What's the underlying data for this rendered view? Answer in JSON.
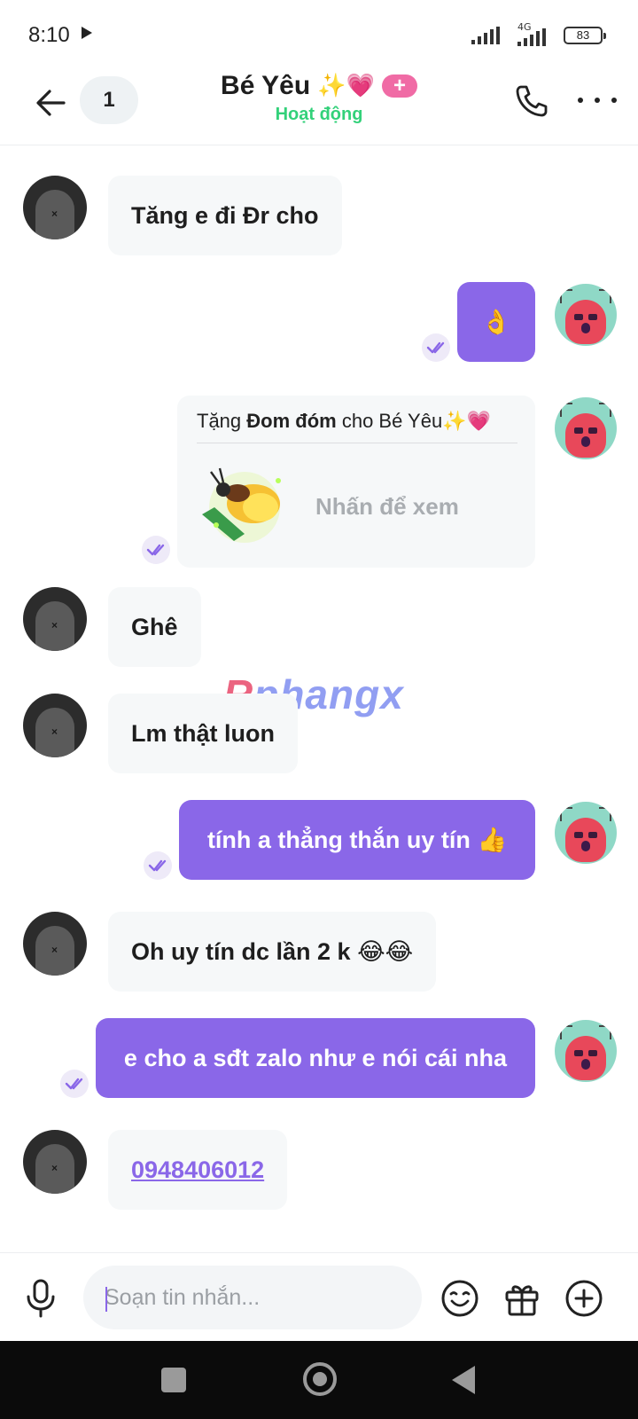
{
  "status_bar": {
    "time": "8:10",
    "network": "4G",
    "battery": "83"
  },
  "header": {
    "unread_count": "1",
    "title": "Bé Yêu",
    "title_emoji": "✨💗",
    "add_label": "+",
    "status": "Hoạt động",
    "status_color": "#33d17a"
  },
  "messages": [
    {
      "side": "in",
      "text": "Tăng e đi Đr cho"
    },
    {
      "side": "out",
      "text": "👌"
    },
    {
      "side": "out",
      "type": "gift",
      "gift_prefix": "Tặng ",
      "gift_name": "Đom đóm",
      "gift_suffix": " cho Bé Yêu",
      "gift_emoji": "✨💗",
      "cta": "Nhấn để xem"
    },
    {
      "side": "in",
      "text": "Ghê"
    },
    {
      "side": "in",
      "text": "Lm thật luon"
    },
    {
      "side": "out",
      "text": "tính a thẳng thắn uy tín",
      "emoji": "👍"
    },
    {
      "side": "in",
      "text": "Oh uy tín dc lần 2 k",
      "emoji": "😂😂"
    },
    {
      "side": "out",
      "text": "e cho a sđt zalo như e nói cái nha"
    },
    {
      "side": "in",
      "text": "0948406012",
      "is_link": true
    }
  ],
  "watermark": {
    "first": "R",
    "rest": "phangx"
  },
  "composer": {
    "placeholder": "Soạn tin nhắn...",
    "icons": [
      "microphone-icon",
      "emoji-icon",
      "gift-icon",
      "plus-icon"
    ]
  },
  "colors": {
    "accent": "#8a67e8",
    "incoming_bubble": "#f6f8f9",
    "active_green": "#33d17a"
  }
}
